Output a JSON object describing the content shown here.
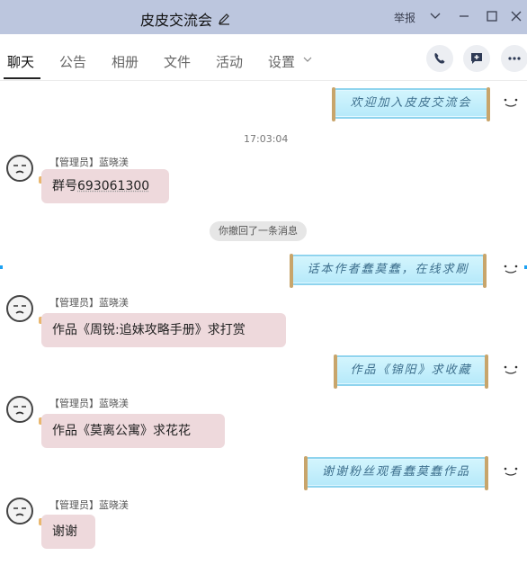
{
  "window": {
    "title": "皮皮交流会",
    "report_label": "举报"
  },
  "tabs": [
    {
      "label": "聊天"
    },
    {
      "label": "公告"
    },
    {
      "label": "相册"
    },
    {
      "label": "文件"
    },
    {
      "label": "活动"
    },
    {
      "label": "设置"
    }
  ],
  "toolbar_icons": [
    "phone-icon",
    "add-message-icon",
    "more-icon"
  ],
  "colors": {
    "titlebar": "#bcc6de",
    "incoming_bubble": "#eed9dc",
    "outgoing_bubble": "#c7eefb"
  },
  "messages": {
    "m1_text": "欢迎加入皮皮交流会",
    "time": "17:03:04",
    "m2_sender": "【管理员】蓝晓渼",
    "m2_prefix": "群号",
    "m2_number": "693061300",
    "recall_notice": "你撤回了一条消息",
    "m3_text": "话本作者蠢莫蠢，在线求刷",
    "m4_sender": "【管理员】蓝晓渼",
    "m4_text": "作品《周锐:追妹攻略手册》求打赏",
    "m5_text": "作品《锦阳》求收藏",
    "m6_sender": "【管理员】蓝晓渼",
    "m6_text": "作品《莫离公寓》求花花",
    "m7_text": "谢谢粉丝观看蠢莫蠢作品",
    "m8_sender": "【管理员】蓝晓渼",
    "m8_text": "谢谢"
  }
}
